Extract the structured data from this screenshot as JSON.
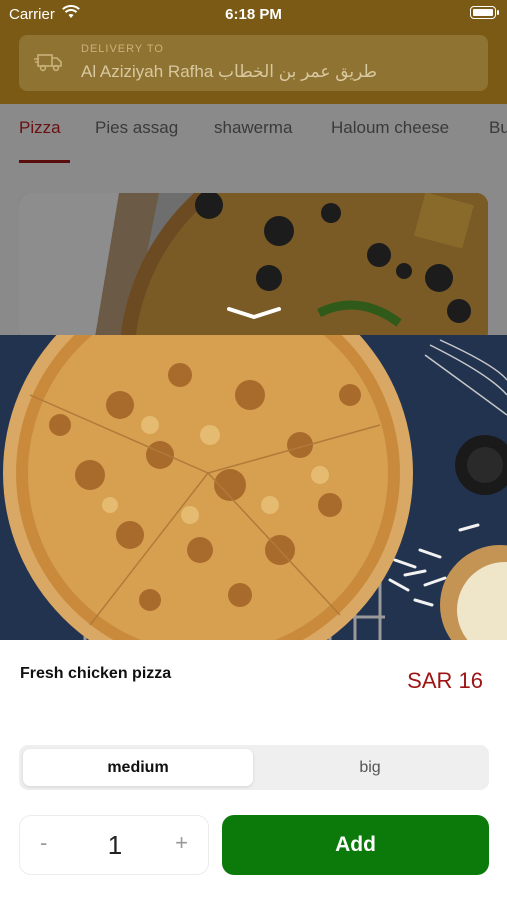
{
  "status_bar": {
    "carrier": "Carrier",
    "time": "6:18 PM"
  },
  "delivery": {
    "label": "DELIVERY TO",
    "address": "Al Aziziyah Rafha طريق عمر بن الخطاب"
  },
  "categories": [
    "Pizza",
    "Pies assag",
    "shawerma",
    "Haloum cheese",
    "Bu"
  ],
  "active_category": "Pizza",
  "product": {
    "name": "Fresh chicken pizza",
    "price": "SAR 16"
  },
  "sizes": {
    "options": [
      "medium",
      "big"
    ],
    "selected": "medium"
  },
  "quantity": {
    "minus": "-",
    "value": "1",
    "plus": "+"
  },
  "add_button": {
    "label": "Add",
    "color": "#0b7a0b"
  },
  "colors": {
    "header": "#7a5a14",
    "accent": "#9e1414",
    "add": "#0b7a0b"
  },
  "icons": [
    "wifi-icon",
    "battery-icon",
    "truck-icon",
    "chevron-down-icon"
  ]
}
